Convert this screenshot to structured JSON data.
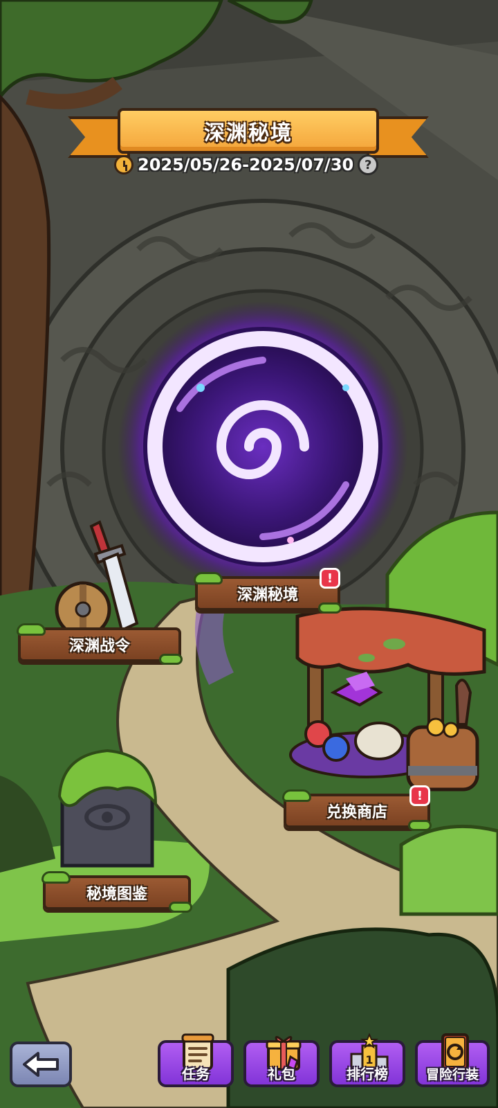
{
  "event": {
    "title": "深渊秘境",
    "date_range": "2025/05/26-2025/07/30",
    "help_glyph": "?"
  },
  "map": {
    "portal_label": "深渊秘境",
    "battle_pass_label": "深渊战令",
    "shop_label": "兑换商店",
    "codex_label": "秘境图鉴",
    "alert_glyph": "!"
  },
  "bottom_nav": {
    "back_icon": "arrow-left-icon",
    "tasks_label": "任务",
    "gift_label": "礼包",
    "ranking_label": "排行榜",
    "gear_label": "冒险行装"
  },
  "colors": {
    "portal_purple": "#8a2be2",
    "accent_orange": "#f4a53a",
    "nav_purple": "#9a48e6",
    "alert_red": "#e8354a"
  }
}
